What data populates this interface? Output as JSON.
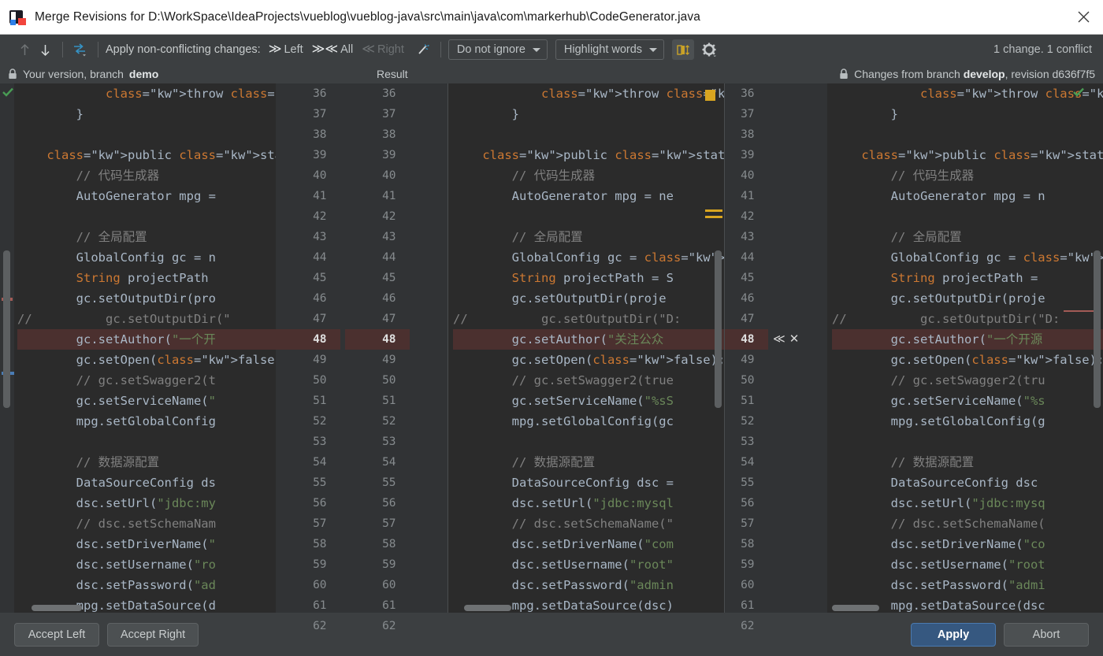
{
  "window": {
    "title": "Merge Revisions for D:\\WorkSpace\\IdeaProjects\\vueblog\\vueblog-java\\src\\main\\java\\com\\markerhub\\CodeGenerator.java",
    "app_icon": "intellij-idea-icon",
    "close_label": "✕"
  },
  "toolbar": {
    "prev_label": "↑",
    "next_label": "↓",
    "apply_all_icon": "apply-changes-icon",
    "apply_label": "Apply non-conflicting changes:",
    "actions": [
      {
        "glyph": "≫",
        "label": "Left",
        "state": "enabled"
      },
      {
        "glyph": "≫≪",
        "label": "All",
        "state": "enabled"
      },
      {
        "glyph": "≪",
        "label": "Right",
        "state": "disabled"
      }
    ],
    "magic_icon": "magic-wand-icon",
    "ignore_combo": "Do not ignore",
    "highlight_combo": "Highlight words",
    "collapse_toggle_icon": "collapse-unchanged-icon",
    "settings_icon": "gear-icon",
    "change_count": "1 change. 1 conflict"
  },
  "headers": {
    "left": {
      "prefix": "Your version, branch ",
      "branch": "demo",
      "lock_icon": "lock-icon"
    },
    "center": "Result",
    "right": {
      "prefix": "Changes from branch ",
      "branch": "develop",
      "suffix": ", revision d636f7f5",
      "lock_icon": "lock-icon"
    }
  },
  "gutter": {
    "left_numbers": [
      "36",
      "37",
      "38",
      "39",
      "40",
      "41",
      "42",
      "43",
      "44",
      "45",
      "46",
      "47",
      "48",
      "49",
      "50",
      "51",
      "52",
      "53",
      "54",
      "55",
      "56",
      "57",
      "58",
      "59",
      "60",
      "61",
      "62"
    ],
    "right_numbers": [
      "36",
      "37",
      "38",
      "39",
      "40",
      "41",
      "42",
      "43",
      "44",
      "45",
      "46",
      "47",
      "48",
      "49",
      "50",
      "51",
      "52",
      "53",
      "54",
      "55",
      "56",
      "57",
      "58",
      "59",
      "60",
      "61",
      "62"
    ],
    "conflict_line": "48",
    "left_actions": {
      "ignore_glyph": "✕",
      "accept_glyph": "≫"
    },
    "right_actions": {
      "accept_glyph": "≪",
      "ignore_glyph": "✕"
    }
  },
  "code": {
    "left_lines": [
      "            throw new MybatisP",
      "        }",
      "",
      "    public static void main",
      "        // 代码生成器",
      "        AutoGenerator mpg =",
      "",
      "        // 全局配置",
      "        GlobalConfig gc = n",
      "        String projectPath",
      "        gc.setOutputDir(pro",
      "//          gc.setOutputDir(\"",
      "        gc.setAuthor(\"一个开",
      "        gc.setOpen(false);",
      "        // gc.setSwagger2(t",
      "        gc.setServiceName(\"",
      "        mpg.setGlobalConfig",
      "",
      "        // 数据源配置",
      "        DataSourceConfig ds",
      "        dsc.setUrl(\"jdbc:my",
      "        // dsc.setSchemaNam",
      "        dsc.setDriverName(\"",
      "        dsc.setUsername(\"ro",
      "        dsc.setPassword(\"ad",
      "        mpg.setDataSource(d"
    ],
    "center_lines": [
      "            throw new MybatisPlus",
      "        }",
      "",
      "    public static void main(St",
      "        // 代码生成器",
      "        AutoGenerator mpg = ne",
      "",
      "        // 全局配置",
      "        GlobalConfig gc = new",
      "        String projectPath = S",
      "        gc.setOutputDir(proje",
      "//          gc.setOutputDir(\"D:",
      "        gc.setAuthor(\"关注公众",
      "        gc.setOpen(false);",
      "        // gc.setSwagger2(true",
      "        gc.setServiceName(\"%sS",
      "        mpg.setGlobalConfig(gc",
      "",
      "        // 数据源配置",
      "        DataSourceConfig dsc =",
      "        dsc.setUrl(\"jdbc:mysql",
      "        // dsc.setSchemaName(\"",
      "        dsc.setDriverName(\"com",
      "        dsc.setUsername(\"root\"",
      "        dsc.setPassword(\"admin",
      "        mpg.setDataSource(dsc)"
    ],
    "right_lines": [
      "            throw new MybatisPlus",
      "        }",
      "",
      "    public static void main(S",
      "        // 代码生成器",
      "        AutoGenerator mpg = n",
      "",
      "        // 全局配置",
      "        GlobalConfig gc = new",
      "        String projectPath =",
      "        gc.setOutputDir(proje",
      "//          gc.setOutputDir(\"D:",
      "        gc.setAuthor(\"一个开源",
      "        gc.setOpen(false);",
      "        // gc.setSwagger2(tru",
      "        gc.setServiceName(\"%s",
      "        mpg.setGlobalConfig(g",
      "",
      "        // 数据源配置",
      "        DataSourceConfig dsc",
      "        dsc.setUrl(\"jdbc:mysq",
      "        // dsc.setSchemaName(",
      "        dsc.setDriverName(\"co",
      "        dsc.setUsername(\"root",
      "        dsc.setPassword(\"admi",
      "        mpg.setDataSource(dsc"
    ]
  },
  "status_icons": {
    "left_ok": "green-check-icon",
    "right_ok": "green-check-icon",
    "center_markers": "yellow-change-marker-icon"
  },
  "footer": {
    "accept_left": "Accept Left",
    "accept_right": "Accept Right",
    "apply": "Apply",
    "abort": "Abort"
  },
  "colors": {
    "accent": "#365880",
    "conflict_bg": "#4b302f",
    "conflict_hl": "#6a3a36",
    "editor_bg": "#2b2b2b",
    "chrome_bg": "#3c3f41",
    "gutter_bg": "#313335",
    "keyword": "#cc7832",
    "string": "#6a8759",
    "comment": "#808080",
    "ok_green": "#499c54",
    "marker_yellow": "#d9a520"
  }
}
